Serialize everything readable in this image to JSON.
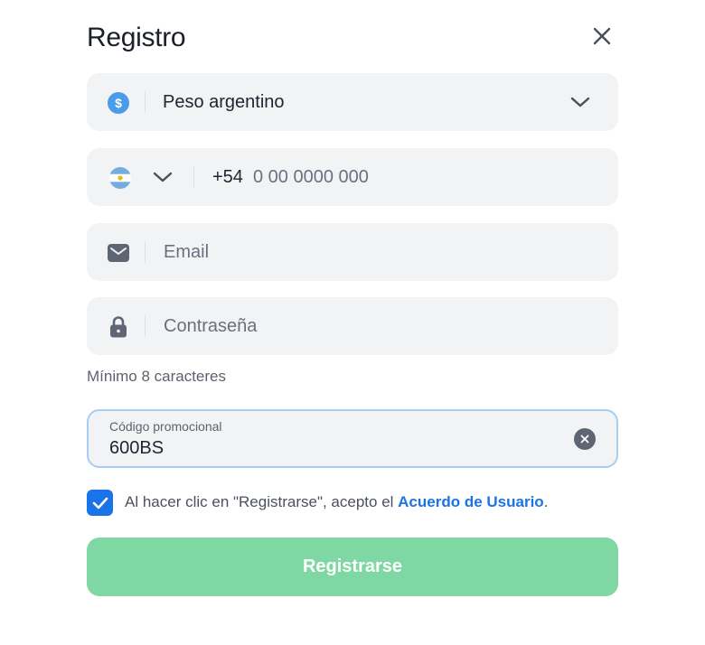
{
  "header": {
    "title": "Registro"
  },
  "currency": {
    "icon": "dollar-coin-icon",
    "value": "Peso argentino"
  },
  "phone": {
    "country_flag": "argentina-flag-icon",
    "prefix": "+54",
    "placeholder": "0 00 0000 000"
  },
  "email": {
    "icon": "envelope-icon",
    "placeholder": "Email"
  },
  "password": {
    "icon": "lock-icon",
    "placeholder": "Contraseña",
    "hint": "Mínimo 8 caracteres"
  },
  "promo": {
    "label": "Código promocional",
    "value": "600BS"
  },
  "terms": {
    "checked": true,
    "text_before": "Al hacer clic en \"Registrarse\", acepto el ",
    "link_text": "Acuerdo de Usuario",
    "text_after": "."
  },
  "submit": {
    "label": "Registrarse"
  },
  "colors": {
    "accent": "#1a73e8",
    "submit_bg": "#7fd8a3",
    "field_bg": "#f2f3f5",
    "focus_border": "#a8cdf5"
  }
}
